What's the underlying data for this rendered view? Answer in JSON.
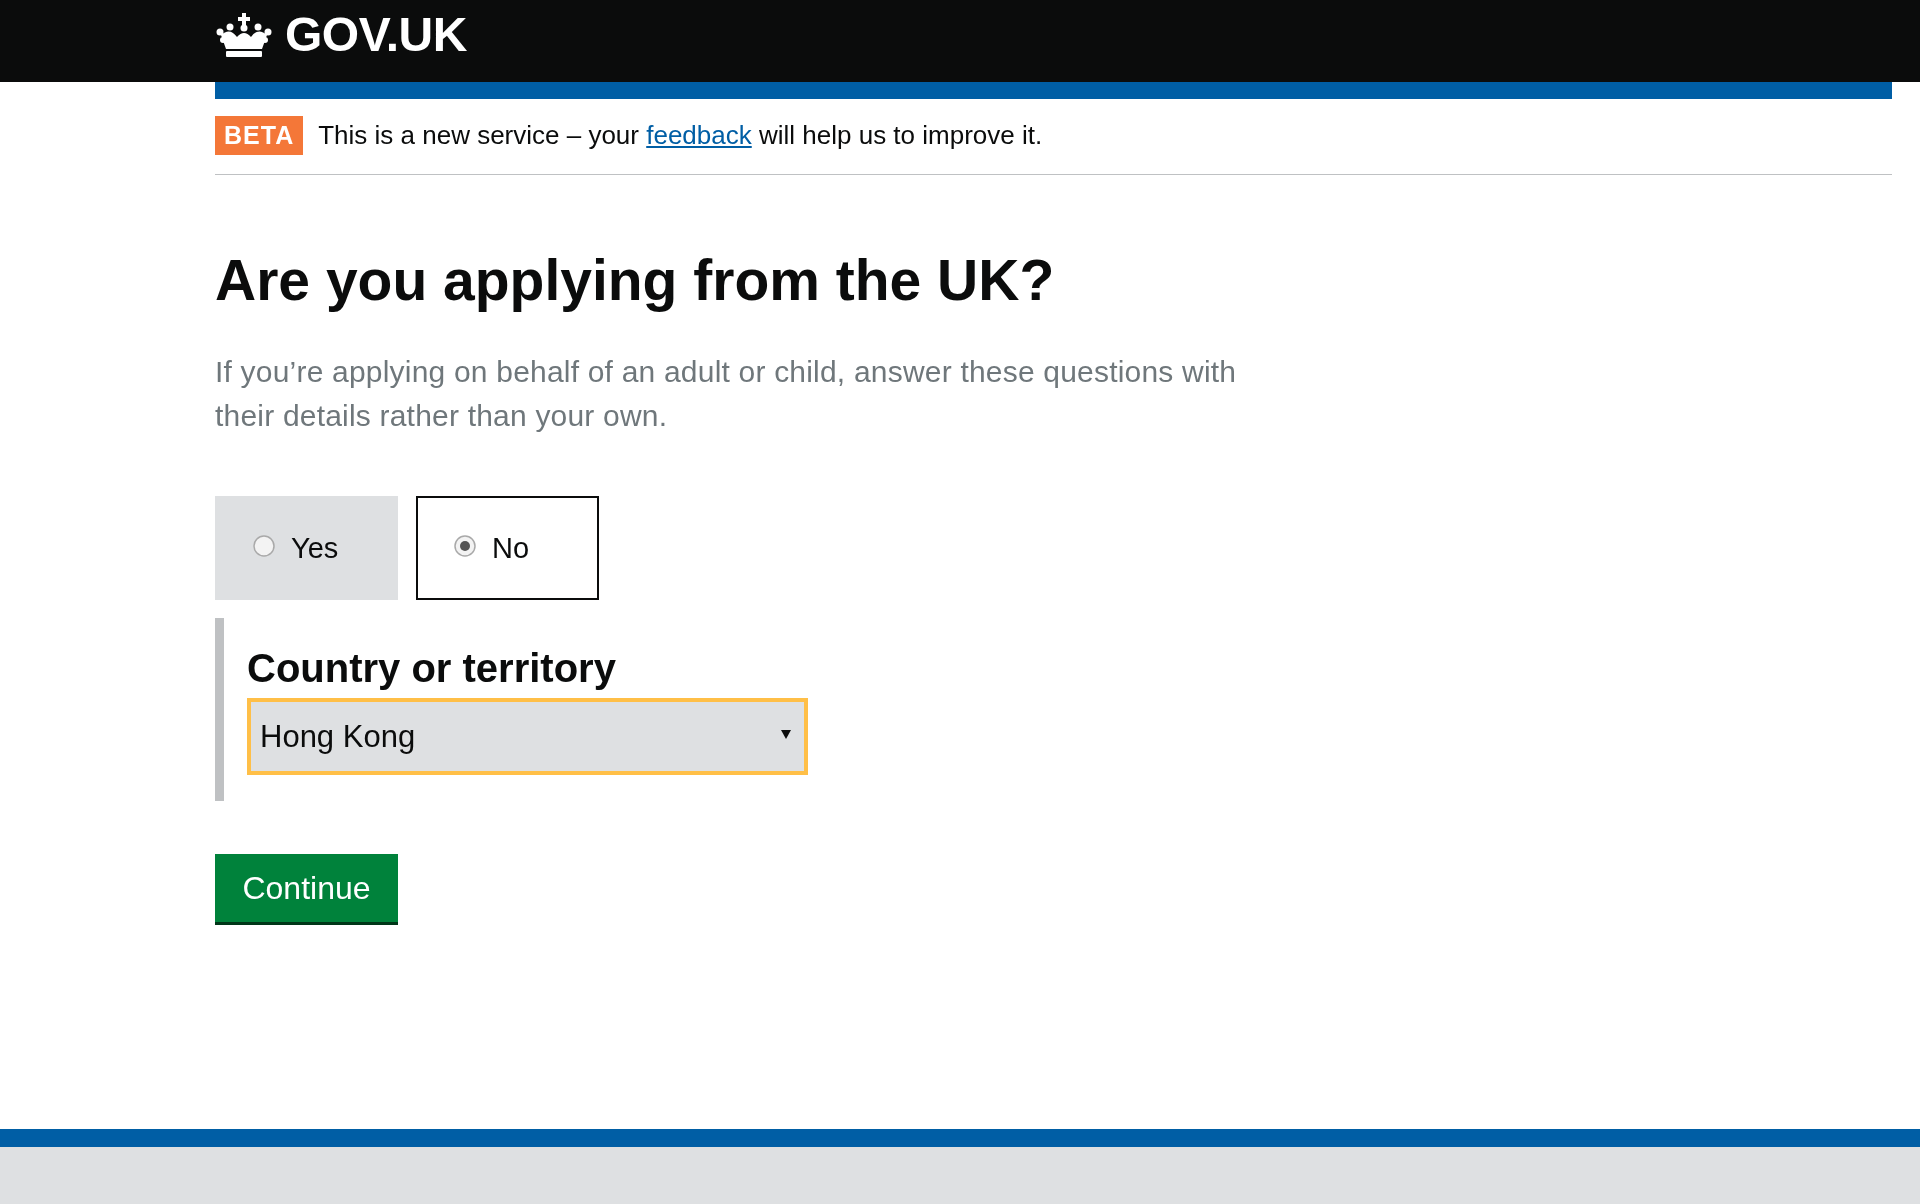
{
  "header": {
    "logo_text": "GOV.UK"
  },
  "phase_banner": {
    "tag": "BETA",
    "text_before": "This is a new service – your",
    "link": "feedback",
    "text_after": "will help us to improve it."
  },
  "heading": "Are you applying from the UK?",
  "lead": "If you’re applying on behalf of an adult or child, answer these questions with their details rather than your own.",
  "options": [
    {
      "label": "Yes",
      "selected": false
    },
    {
      "label": "No",
      "selected": true
    }
  ],
  "country": {
    "label": "Country or territory",
    "value": "Hong Kong",
    "focused": true
  },
  "button": "Continue"
}
